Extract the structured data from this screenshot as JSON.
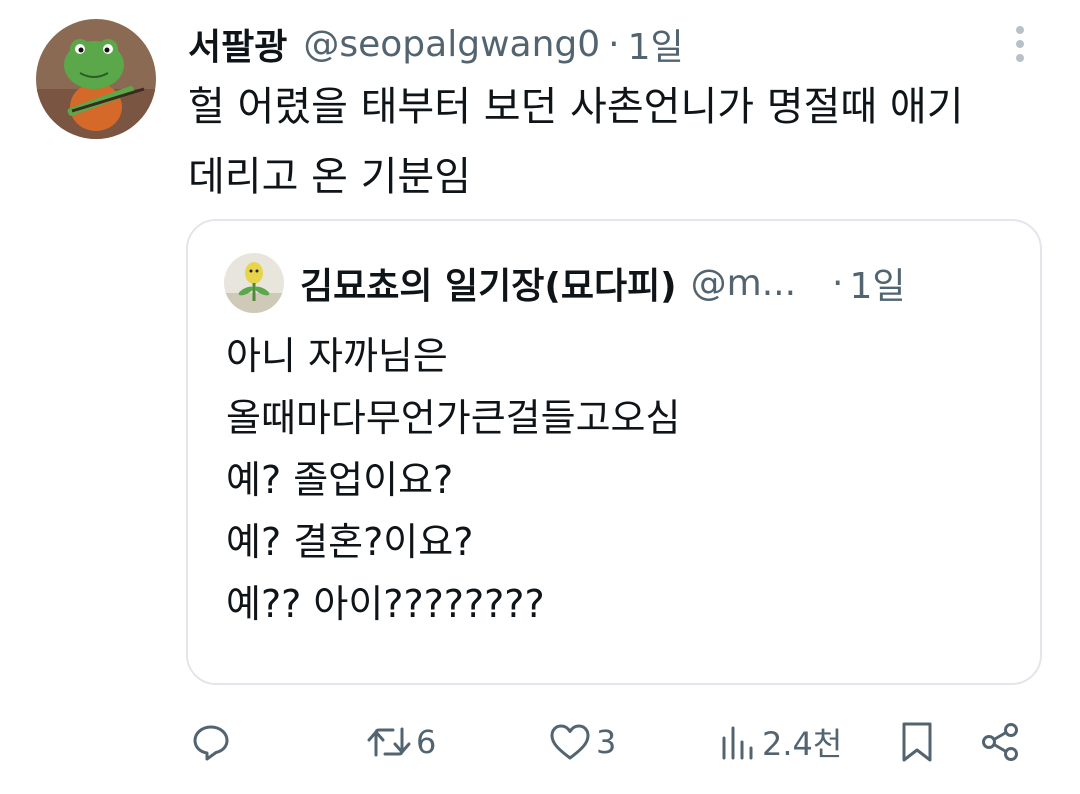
{
  "tweet": {
    "display_name": "서팔광",
    "handle": "@seopalgwang0",
    "separator": "·",
    "time": "1일",
    "text_lines": [
      "헐 어렸을 태부터 보던 사촌언니가 명절때 애기",
      "데리고 온 기분임"
    ]
  },
  "quoted": {
    "display_name": "김묘쵸의 일기장(묘다피)",
    "handle": "@m...",
    "separator": "·",
    "time": "1일",
    "text_lines": [
      "아니 자까님은",
      "올때마다무언가큰걸들고오심",
      "예? 졸업이요?",
      "예? 결혼?이요?",
      "예?? 아이????????"
    ]
  },
  "actions": {
    "reply_count": "",
    "retweet_count": "6",
    "like_count": "3",
    "views_count": "2.4천"
  },
  "icons": {
    "more": "more-vertical-icon",
    "reply": "reply-icon",
    "retweet": "retweet-icon",
    "like": "heart-icon",
    "views": "views-chart-icon",
    "bookmark": "bookmark-icon",
    "share": "share-icon"
  },
  "colors": {
    "text_primary": "#0f1419",
    "text_secondary": "#536471",
    "border": "#e2e6ea",
    "avatar_bg": "#8a6a52",
    "frog_green": "#5aa84a"
  }
}
